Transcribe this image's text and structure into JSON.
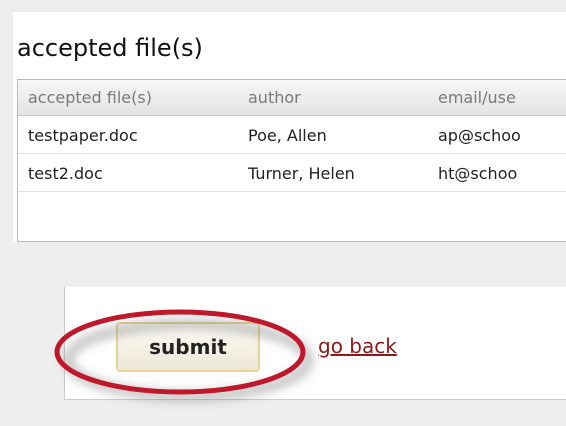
{
  "section": {
    "title": "accepted file(s)"
  },
  "table": {
    "headers": [
      "accepted file(s)",
      "author",
      "email/use"
    ],
    "rows": [
      {
        "file": "testpaper.doc",
        "author": "Poe, Allen",
        "email": "ap@schoo"
      },
      {
        "file": "test2.doc",
        "author": "Turner, Helen",
        "email": "ht@schoo"
      }
    ]
  },
  "actions": {
    "submit_label": "submit",
    "go_back_label": "go back"
  },
  "colors": {
    "highlight_oval": "#c0182b",
    "link": "#8b1a1a",
    "button_border": "#e7d393"
  }
}
